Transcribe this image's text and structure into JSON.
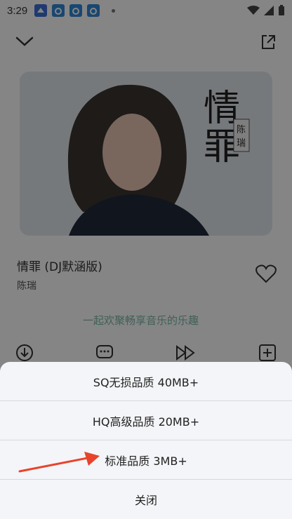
{
  "status_bar": {
    "time": "3:29",
    "icons": [
      "notification-app-icon",
      "notification-app-icon",
      "notification-app-icon",
      "notification-app-icon"
    ],
    "right_icons": [
      "wifi-icon",
      "signal-icon",
      "battery-icon"
    ]
  },
  "player": {
    "song_title": "情罪 (DJ默涵版)",
    "artist": "陈瑞",
    "cover_text": {
      "title": "情罪",
      "artist": "陈瑞"
    },
    "faded_text": "一起欢聚畅享音乐的乐趣"
  },
  "quality_sheet": {
    "options": [
      {
        "label": "SQ无损品质 40MB+"
      },
      {
        "label": "HQ高级品质 20MB+"
      },
      {
        "label": "标准品质 3MB+"
      }
    ],
    "close_label": "关闭"
  },
  "colors": {
    "overlay": "#000000",
    "sheet_bg": "#f4f5f8",
    "annotation_arrow": "#e8432d",
    "accent": "#7ab8a8"
  }
}
